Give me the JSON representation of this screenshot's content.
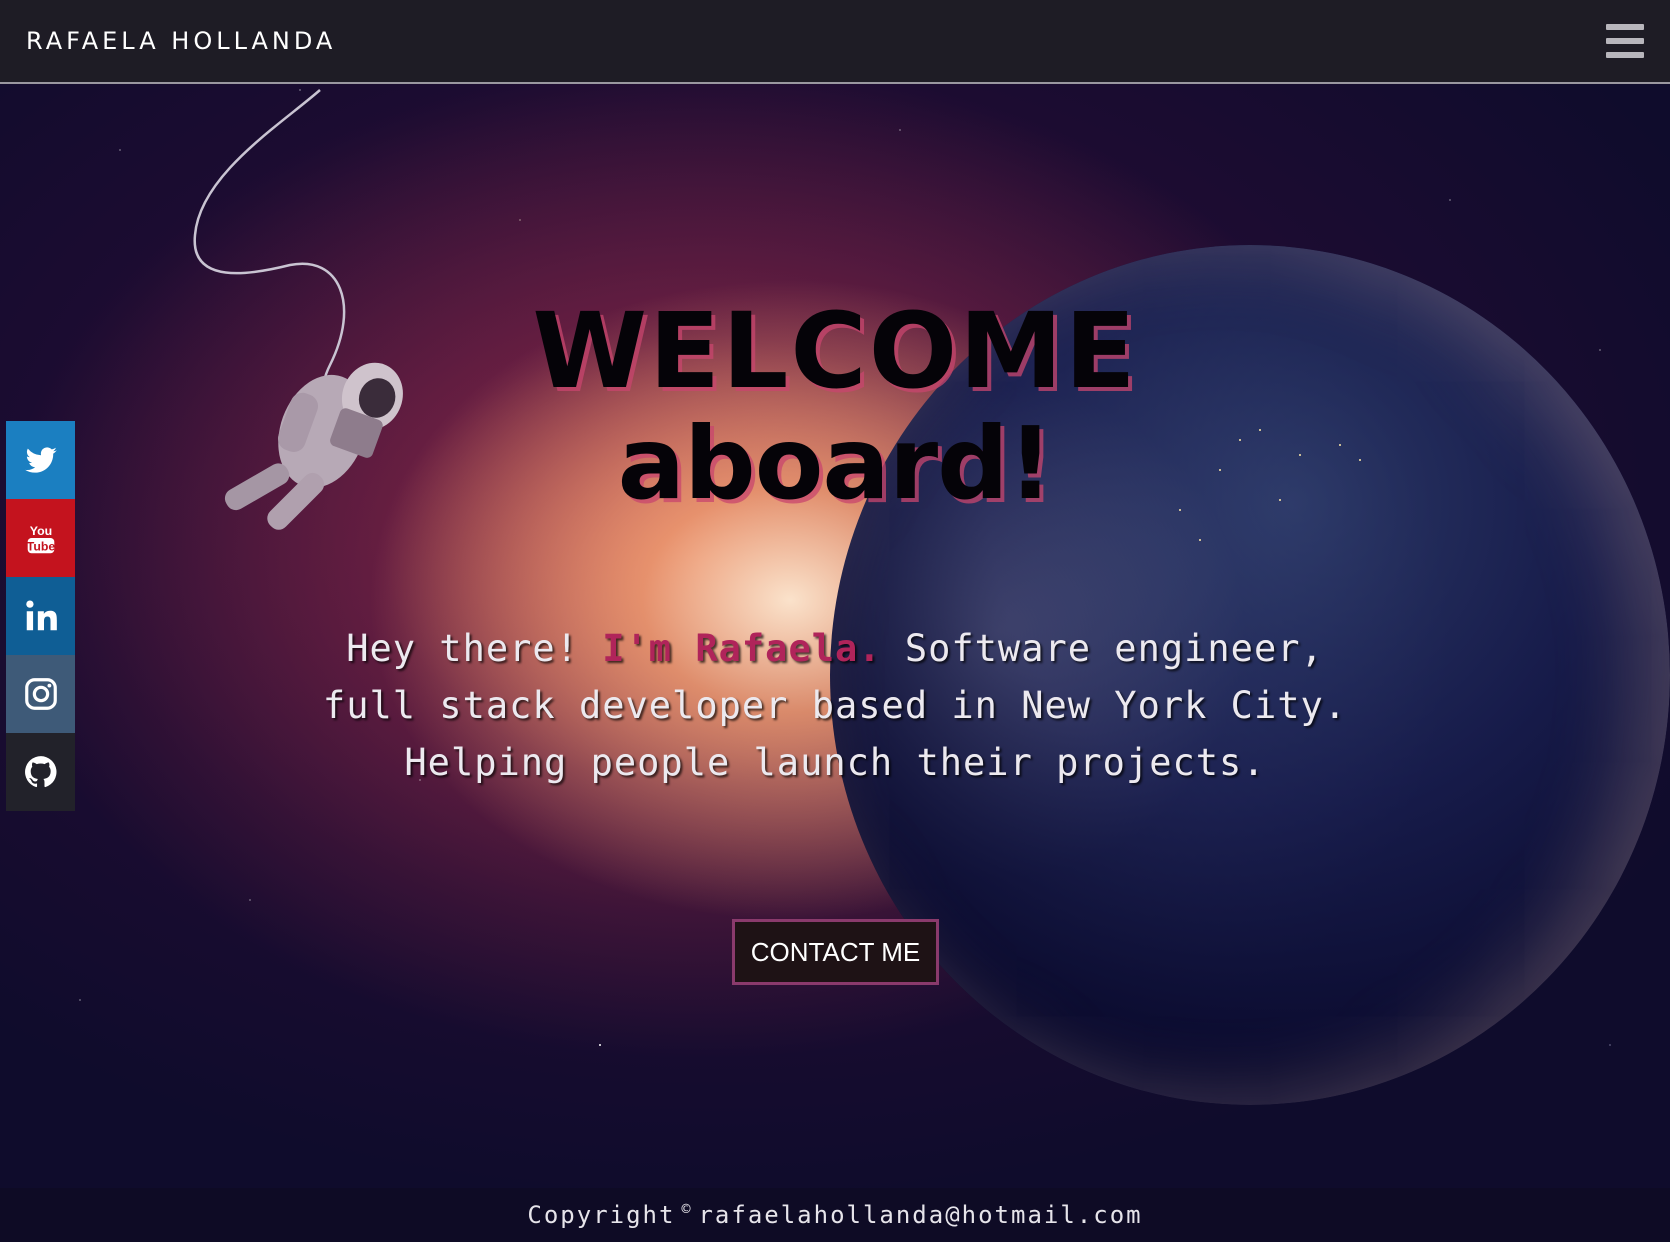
{
  "header": {
    "brand": "RAFAELA HOLLANDA",
    "menu_icon": "hamburger-menu-icon"
  },
  "social": [
    {
      "name": "twitter",
      "icon": "twitter-bird-icon",
      "color": "#1b7fc1"
    },
    {
      "name": "youtube",
      "icon": "youtube-icon",
      "color": "#c4131e"
    },
    {
      "name": "linkedin",
      "icon": "linkedin-icon",
      "color": "#0f5e95"
    },
    {
      "name": "instagram",
      "icon": "instagram-icon",
      "color": "#3e5a78"
    },
    {
      "name": "github",
      "icon": "github-icon",
      "color": "#22222a"
    }
  ],
  "hero": {
    "title_line1": "WELCOME",
    "title_line2": "aboard!",
    "intro_greeting": "Hey there! ",
    "intro_name": "I'm Rafaela.",
    "intro_rest_1": " Software engineer,",
    "intro_line2": "full stack developer based in New York City.",
    "intro_line3": "Helping people launch their projects.",
    "cta": "CONTACT ME"
  },
  "footer": {
    "prefix": "Copyright",
    "symbol": "©",
    "email": "rafaelahollanda@hotmail.com"
  },
  "colors": {
    "accent": "#b0245a",
    "button_border": "#8a3a6c",
    "topbar": "#1e1c25"
  }
}
